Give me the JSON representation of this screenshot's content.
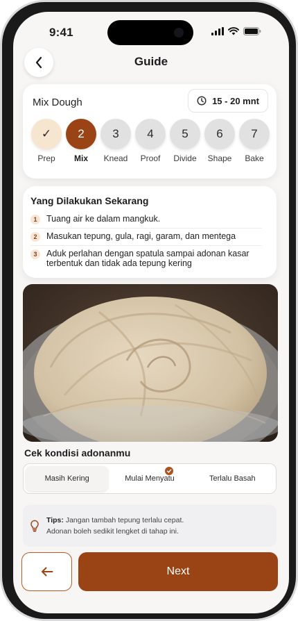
{
  "status": {
    "time": "9:41"
  },
  "header": {
    "title": "Guide"
  },
  "step_card": {
    "title": "Mix Dough",
    "duration": "15 - 20 mnt",
    "steps": [
      {
        "symbol": "✓",
        "label": "Prep",
        "state": "done"
      },
      {
        "symbol": "2",
        "label": "Mix",
        "state": "active"
      },
      {
        "symbol": "3",
        "label": "Knead",
        "state": "pending"
      },
      {
        "symbol": "4",
        "label": "Proof",
        "state": "pending"
      },
      {
        "symbol": "5",
        "label": "Divide",
        "state": "pending"
      },
      {
        "symbol": "6",
        "label": "Shape",
        "state": "pending"
      },
      {
        "symbol": "7",
        "label": "Bake",
        "state": "pending"
      }
    ]
  },
  "current": {
    "title": "Yang Dilakukan Sekarang",
    "items": [
      {
        "num": "1",
        "text": "Tuang air ke dalam mangkuk."
      },
      {
        "num": "2",
        "text": "Masukan tepung, gula, ragi, garam, dan mentega"
      },
      {
        "num": "3",
        "text": "Aduk perlahan dengan spatula sampai adonan kasar terbentuk dan tidak ada tepung kering"
      }
    ]
  },
  "condition": {
    "title": "Cek kondisi adonanmu",
    "options": [
      "Masih Kering",
      "Mulai Menyatu",
      "Terlalu Basah"
    ],
    "selected": "Masih Kering",
    "checked": "Mulai Menyatu"
  },
  "tips": {
    "label": "Tips:",
    "line1": "Jangan tambah tepung terlalu cepat.",
    "line2": "Adonan boleh sedikit lengket di tahap ini."
  },
  "footer": {
    "next_label": "Next"
  },
  "colors": {
    "accent": "#9a4315",
    "done": "#f6e5cf",
    "pending": "#e1e1e1"
  }
}
